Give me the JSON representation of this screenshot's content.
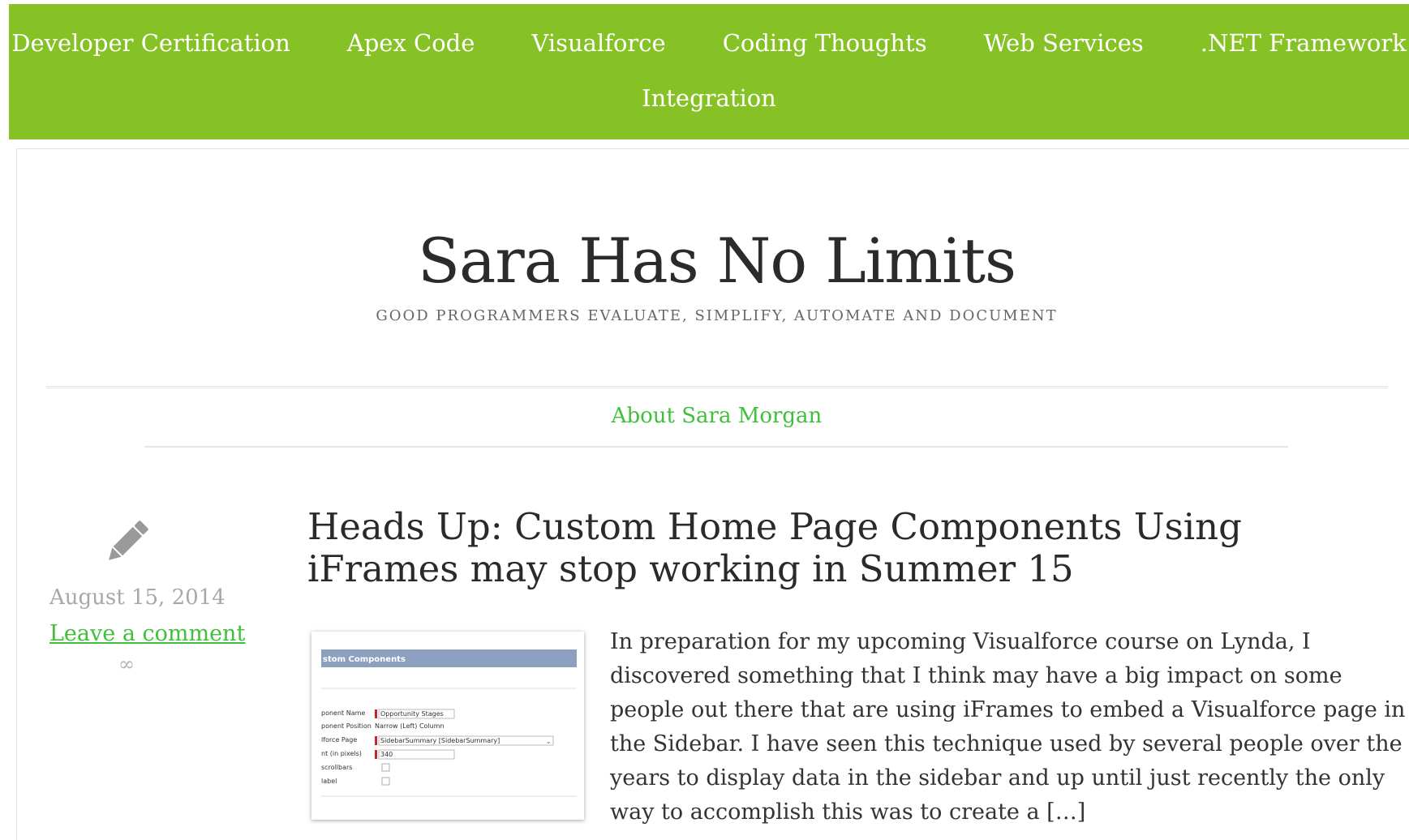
{
  "nav": {
    "items": [
      {
        "label": "Developer Certification"
      },
      {
        "label": "Apex Code"
      },
      {
        "label": "Visualforce"
      },
      {
        "label": "Coding Thoughts"
      },
      {
        "label": "Web Services"
      },
      {
        "label": ".NET Framework"
      },
      {
        "label": "Integration"
      }
    ]
  },
  "header": {
    "site_title": "Sara Has No Limits",
    "tagline": "GOOD PROGRAMMERS EVALUATE, SIMPLIFY, AUTOMATE AND DOCUMENT"
  },
  "menu": {
    "about_label": "About Sara Morgan"
  },
  "post": {
    "icon": "pencil-icon",
    "date": "August 15, 2014",
    "comment_label": "Leave a comment",
    "permalink_symbol": "∞",
    "title": "Heads Up: Custom Home Page Components Using iFrames may stop working in Summer 15",
    "excerpt": "In preparation for my upcoming Visualforce course on Lynda, I discovered something that I think may have a big impact on some people out there that are using iFrames to embed a Visualforce page in the Sidebar. I have seen this technique used by several people over the years to display data in the sidebar and up until just recently the only way to accomplish this was to create a […]",
    "thumbnail": {
      "header": "stom Components",
      "rows": [
        {
          "label": "ponent Name",
          "value": "Opportunity Stages"
        },
        {
          "label": "ponent Position",
          "value": "Narrow (Left) Column"
        },
        {
          "label": "lforce Page",
          "value": "SidebarSummary [SidebarSummary]"
        },
        {
          "label": "nt (in pixels)",
          "value": "340"
        },
        {
          "label": "scrollbars",
          "value": ""
        },
        {
          "label": "label",
          "value": ""
        }
      ]
    }
  },
  "colors": {
    "nav_bg": "#86c226",
    "accent_link": "#3fc03a",
    "thumb_header": "#8ea0bf"
  }
}
